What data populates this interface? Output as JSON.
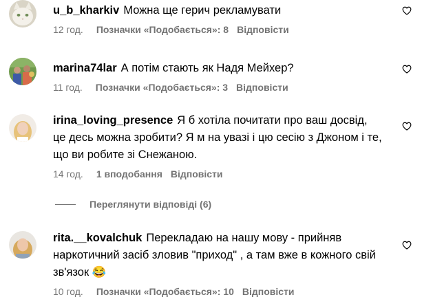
{
  "comments": [
    {
      "username": "u_b_kharkiv",
      "text": "Можна ще герич рекламувати",
      "time": "12 год.",
      "likes": "Позначки «Подобається»: 8",
      "reply": "Відповісти"
    },
    {
      "username": "marina74lar",
      "text": "А потім стають як Надя Мейхер?",
      "time": "11 год.",
      "likes": "Позначки «Подобається»: 3",
      "reply": "Відповісти"
    },
    {
      "username": "irina_loving_presence",
      "text": "Я б хотіла почитати про ваш досвід, це десь можна зробити? Я м на увазі і цю сесію з Джоном і те, що ви робите зі Снежаною.",
      "time": "14 год.",
      "likes": "1 вподобання",
      "reply": "Відповісти"
    },
    {
      "username": "rita.__kovalchuk",
      "text": "Перекладаю на нашу мову - прийняв наркотичний засіб зловив \"приход\" , а там вже в кожного свій зв'язок",
      "emoji": "😂",
      "time": "10 год.",
      "likes": "Позначки «Подобається»: 10",
      "reply": "Відповісти"
    }
  ],
  "view_replies": {
    "label": "Переглянути відповіді (6)"
  },
  "icons": {
    "like": "heart-outline-icon"
  },
  "colors": {
    "meta_text": "#737373",
    "primary_text": "#000000",
    "background": "#ffffff"
  }
}
